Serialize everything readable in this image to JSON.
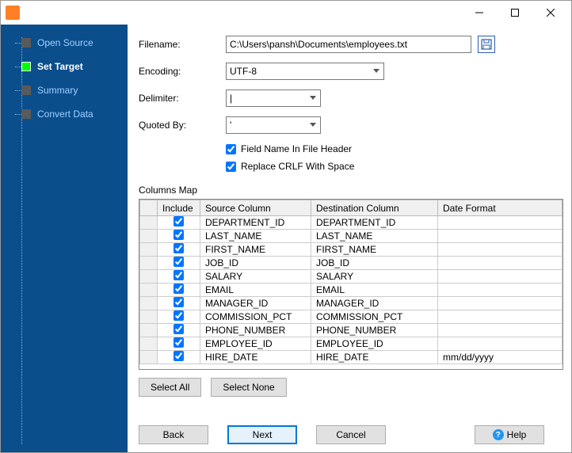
{
  "titlebar": {
    "title": ""
  },
  "sidebar": {
    "items": [
      {
        "label": "Open Source",
        "active": false
      },
      {
        "label": "Set Target",
        "active": true
      },
      {
        "label": "Summary",
        "active": false
      },
      {
        "label": "Convert Data",
        "active": false
      }
    ]
  },
  "form": {
    "filename_label": "Filename:",
    "filename_value": "C:\\Users\\pansh\\Documents\\employees.txt",
    "encoding_label": "Encoding:",
    "encoding_value": "UTF-8",
    "delimiter_label": "Delimiter:",
    "delimiter_value": "|",
    "quotedby_label": "Quoted By:",
    "quotedby_value": "'",
    "cb_field_header": "Field Name In File Header",
    "cb_field_header_checked": true,
    "cb_replace_crlf": "Replace CRLF With Space",
    "cb_replace_crlf_checked": true
  },
  "columns_map": {
    "label": "Columns Map",
    "headers": {
      "include": "Include",
      "source": "Source Column",
      "dest": "Destination Column",
      "format": "Date Format"
    },
    "rows": [
      {
        "include": true,
        "source": "DEPARTMENT_ID",
        "dest": "DEPARTMENT_ID",
        "format": ""
      },
      {
        "include": true,
        "source": "LAST_NAME",
        "dest": "LAST_NAME",
        "format": ""
      },
      {
        "include": true,
        "source": "FIRST_NAME",
        "dest": "FIRST_NAME",
        "format": ""
      },
      {
        "include": true,
        "source": "JOB_ID",
        "dest": "JOB_ID",
        "format": ""
      },
      {
        "include": true,
        "source": "SALARY",
        "dest": "SALARY",
        "format": ""
      },
      {
        "include": true,
        "source": "EMAIL",
        "dest": "EMAIL",
        "format": ""
      },
      {
        "include": true,
        "source": "MANAGER_ID",
        "dest": "MANAGER_ID",
        "format": ""
      },
      {
        "include": true,
        "source": "COMMISSION_PCT",
        "dest": "COMMISSION_PCT",
        "format": ""
      },
      {
        "include": true,
        "source": "PHONE_NUMBER",
        "dest": "PHONE_NUMBER",
        "format": ""
      },
      {
        "include": true,
        "source": "EMPLOYEE_ID",
        "dest": "EMPLOYEE_ID",
        "format": ""
      },
      {
        "include": true,
        "source": "HIRE_DATE",
        "dest": "HIRE_DATE",
        "format": "mm/dd/yyyy"
      }
    ]
  },
  "buttons": {
    "select_all": "Select All",
    "select_none": "Select None",
    "back": "Back",
    "next": "Next",
    "cancel": "Cancel",
    "help": "Help"
  }
}
